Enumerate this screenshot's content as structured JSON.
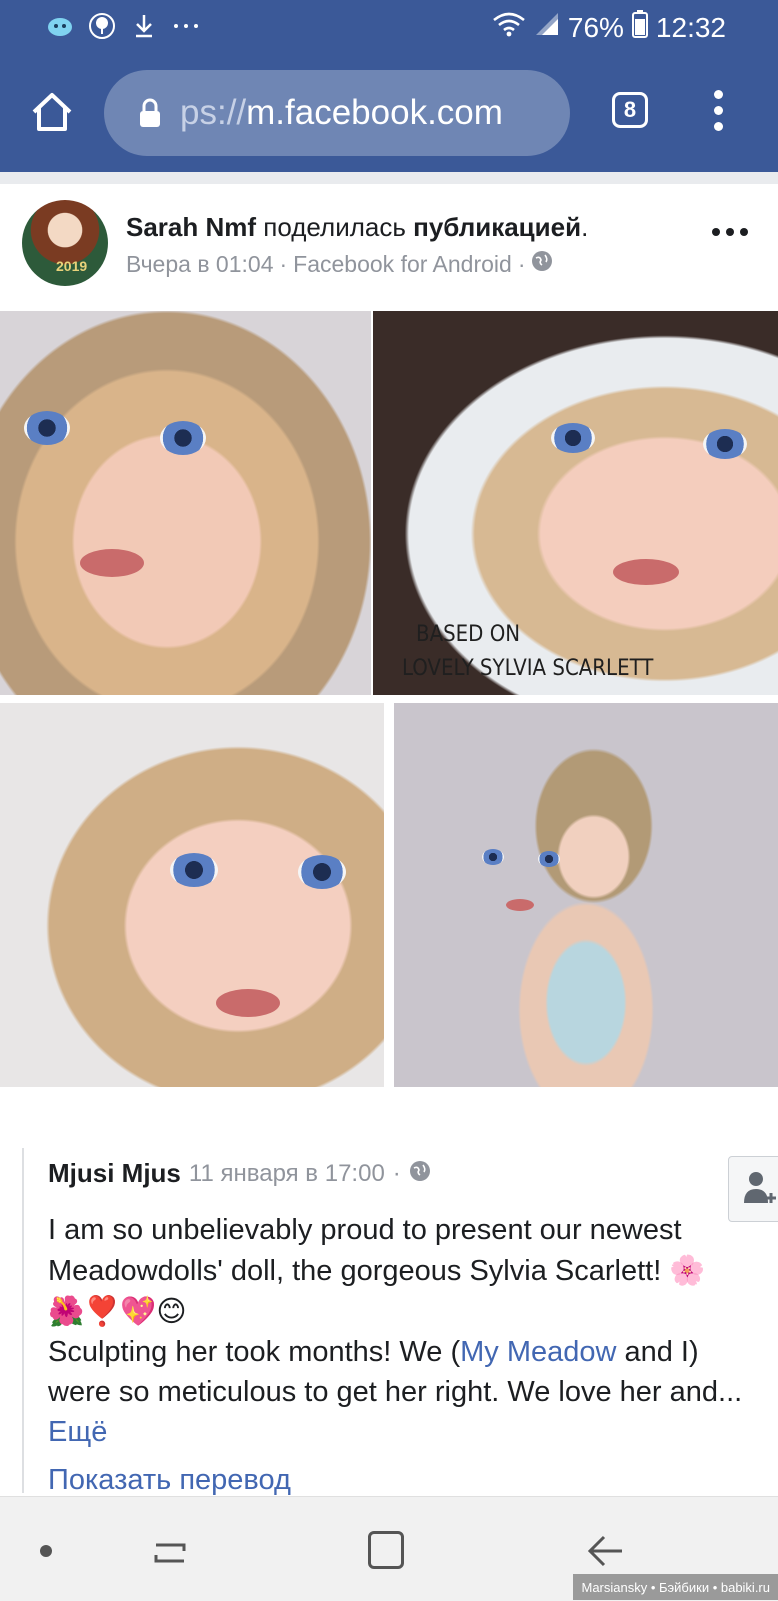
{
  "status_bar": {
    "battery": "76%",
    "time": "12:32",
    "icons": [
      "ghost-notification-icon",
      "tree-notification-icon",
      "download-icon",
      "more-notifications-icon",
      "wifi-icon",
      "signal-icon",
      "battery-icon"
    ]
  },
  "browser": {
    "url_prefix": "ps://",
    "url_host": "m.facebook.com",
    "tab_count": "8"
  },
  "post": {
    "author": "Sarah Nmf",
    "action_text": "поделилась",
    "action_object": "публикацией",
    "action_end": ".",
    "avatar_year": "2019",
    "time": "Вчера в 01:04",
    "sep1": "·",
    "source": "Facebook for Android",
    "sep2": "·"
  },
  "photos": {
    "overlay_line1": "BASED ON",
    "overlay_line2": "LOVELY SYLVIA SCARLETT"
  },
  "shared_post": {
    "author": "Mjusi Mjus",
    "time": "11 января в 17:00",
    "sep": "·",
    "text_1": "I am so unbelievably proud to present our newest Meadowdolls' doll, the gorgeous Sylvia Scarlett!",
    "emojis": "🌸🌺❣️💖😊",
    "text_2": "Sculpting her took months! We (",
    "link": "My Meadow",
    "text_3": " and I) were so meticulous to get her right. We love her and...",
    "more": "Ещё",
    "translate": "Показать перевод"
  },
  "watermark": "Marsiansky • Бэйбики • babiki.ru",
  "colors": {
    "facebook_blue": "#3b5998",
    "link_blue": "#4267b2",
    "meta_grey": "#90949c"
  }
}
